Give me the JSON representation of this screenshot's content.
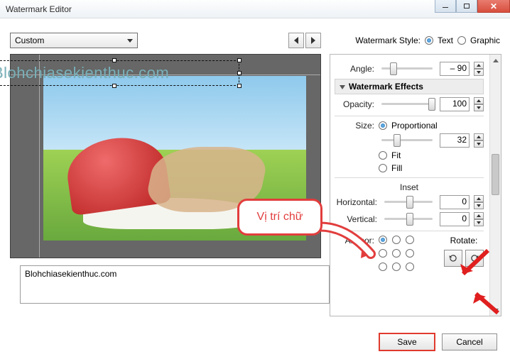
{
  "window": {
    "title": "Watermark Editor"
  },
  "preset": {
    "selected": "Custom"
  },
  "watermark_style": {
    "label": "Watermark Style:",
    "text_label": "Text",
    "graphic_label": "Graphic",
    "selected": "Text"
  },
  "preview": {
    "watermark_text": "Blohchiasekienthuc.com"
  },
  "settings": {
    "angle": {
      "label": "Angle:",
      "value": "– 90"
    },
    "effects_header": "Watermark Effects",
    "opacity": {
      "label": "Opacity:",
      "value": "100"
    },
    "size": {
      "label": "Size:",
      "mode_proportional": "Proportional",
      "mode_fit": "Fit",
      "mode_fill": "Fill",
      "value": "32",
      "selected": "Proportional"
    },
    "inset": {
      "header": "Inset",
      "horizontal_label": "Horizontal:",
      "vertical_label": "Vertical:",
      "horizontal_value": "0",
      "vertical_value": "0"
    },
    "anchor": {
      "label": "Anchor:",
      "selected_index": 0
    },
    "rotate": {
      "label": "Rotate:"
    }
  },
  "watermark_input": {
    "value": "Blohchiasekienthuc.com"
  },
  "buttons": {
    "save": "Save",
    "cancel": "Cancel"
  },
  "callout": {
    "text": "Vị trí chữ"
  }
}
